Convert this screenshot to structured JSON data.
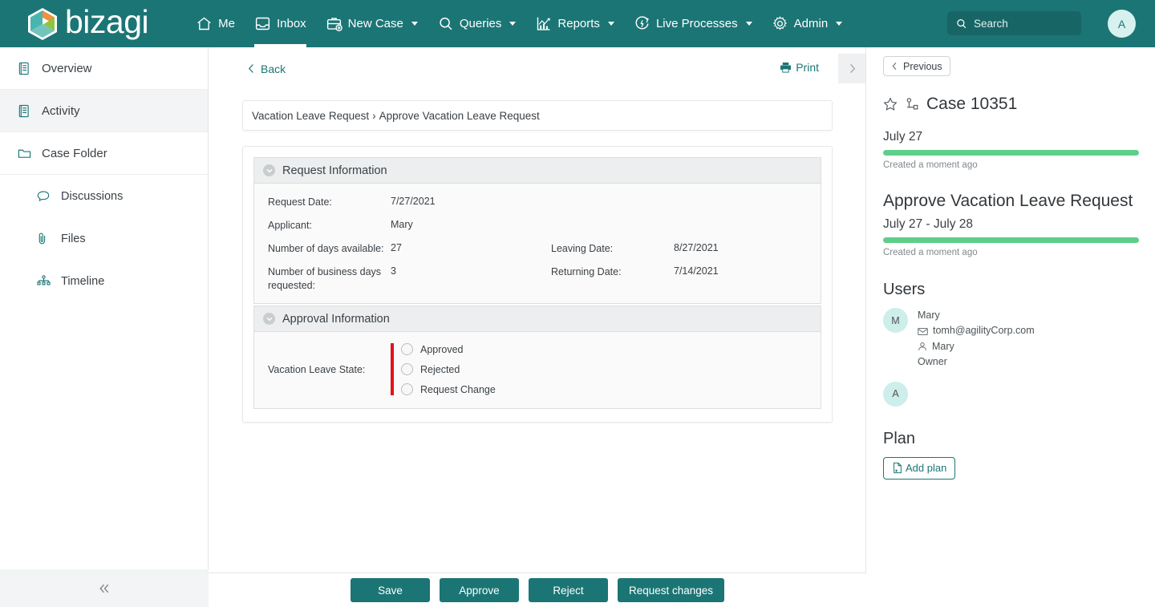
{
  "brand": {
    "name": "bizagi"
  },
  "topnav": {
    "items": [
      {
        "label": "Me",
        "icon": "home-icon",
        "caret": false,
        "active": false
      },
      {
        "label": "Inbox",
        "icon": "inbox-icon",
        "caret": false,
        "active": true
      },
      {
        "label": "New Case",
        "icon": "briefcase-plus-icon",
        "caret": true,
        "active": false
      },
      {
        "label": "Queries",
        "icon": "search-icon",
        "caret": true,
        "active": false
      },
      {
        "label": "Reports",
        "icon": "chart-icon",
        "caret": true,
        "active": false
      },
      {
        "label": "Live Processes",
        "icon": "live-processes-icon",
        "caret": true,
        "active": false
      },
      {
        "label": "Admin",
        "icon": "gear-icon",
        "caret": true,
        "active": false
      }
    ],
    "search_placeholder": "Search",
    "avatar_initial": "A"
  },
  "sidebar": {
    "items": [
      {
        "label": "Overview",
        "icon": "document-icon",
        "active": false,
        "sub": false
      },
      {
        "label": "Activity",
        "icon": "document-icon",
        "active": true,
        "sub": false
      },
      {
        "label": "Case Folder",
        "icon": "folder-icon",
        "active": false,
        "sub": false
      },
      {
        "label": "Discussions",
        "icon": "comment-icon",
        "active": false,
        "sub": true
      },
      {
        "label": "Files",
        "icon": "paperclip-icon",
        "active": false,
        "sub": true
      },
      {
        "label": "Timeline",
        "icon": "timeline-icon",
        "active": false,
        "sub": true
      }
    ],
    "collapse_icon": "double-chevron-left-icon"
  },
  "main": {
    "back_label": "Back",
    "print_label": "Print",
    "next_icon": "chevron-right-icon",
    "breadcrumb": {
      "process": "Vacation Leave Request",
      "separator": "›",
      "task": "Approve Vacation Leave Request"
    },
    "sections": [
      {
        "title": "Request Information",
        "rows": [
          {
            "layout": "single",
            "label": "Request Date:",
            "value": "7/27/2021"
          },
          {
            "layout": "single",
            "label": "Applicant:",
            "value": "Mary"
          },
          {
            "layout": "double",
            "label": "Number of days available:",
            "value": "27",
            "label2": "Leaving Date:",
            "value2": "8/27/2021"
          },
          {
            "layout": "double",
            "label": "Number of business days requested:",
            "value": "3",
            "label2": "Returning Date:",
            "value2": "7/14/2021"
          }
        ]
      },
      {
        "title": "Approval Information",
        "radio_label": "Vacation Leave State:",
        "radio_options": [
          "Approved",
          "Rejected",
          "Request Change"
        ]
      }
    ]
  },
  "rightpanel": {
    "previous_label": "Previous",
    "favorite_icon": "star-icon",
    "share_icon": "share-nodes-icon",
    "case_title": "Case 10351",
    "stages": [
      {
        "name": "",
        "date": "July 27",
        "note": "Created a moment ago",
        "progress_color": "#5ece8a"
      },
      {
        "name": "Approve Vacation Leave Request",
        "date": "July 27 - July 28",
        "note": "Created a moment ago",
        "progress_color": "#5ece8a"
      }
    ],
    "users_heading": "Users",
    "users": [
      {
        "initial": "M",
        "name": "Mary",
        "email": "tomh@agilityCorp.com",
        "email_icon": "envelope-icon",
        "account": "Mary",
        "account_icon": "person-icon",
        "role": "Owner"
      },
      {
        "initial": "A",
        "name": "",
        "email": "",
        "account": "",
        "role": ""
      }
    ],
    "plan_heading": "Plan",
    "add_plan_label": "Add plan",
    "add_plan_icon": "file-plus-icon"
  },
  "footer": {
    "buttons": [
      {
        "label": "Save"
      },
      {
        "label": "Approve"
      },
      {
        "label": "Reject"
      },
      {
        "label": "Request changes"
      }
    ]
  },
  "colors": {
    "brand_teal": "#1c7575",
    "progress_green": "#5ece8a",
    "required_red": "#e4111a",
    "avatar_mint": "#cdeeea"
  }
}
